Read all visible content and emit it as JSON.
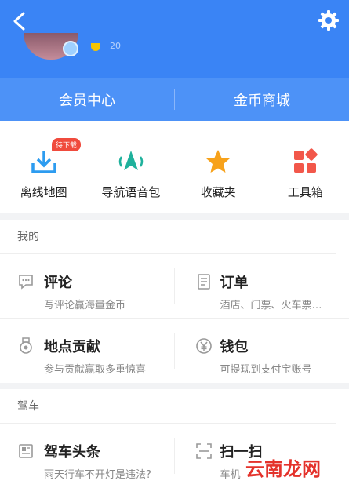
{
  "header": {
    "level_text": "20",
    "tabs": [
      "会员中心",
      "金币商城"
    ]
  },
  "tools": [
    {
      "label": "离线地图",
      "badge": "待下载",
      "icon": "download-icon"
    },
    {
      "label": "导航语音包",
      "icon": "navigation-arrow-icon"
    },
    {
      "label": "收藏夹",
      "icon": "star-icon"
    },
    {
      "label": "工具箱",
      "icon": "toolbox-icon"
    }
  ],
  "mine": {
    "title": "我的",
    "items": [
      {
        "title": "评论",
        "subtitle": "写评论赢海量金币",
        "icon": "comment-icon"
      },
      {
        "title": "订单",
        "subtitle": "酒店、门票、火车票…",
        "icon": "order-icon"
      },
      {
        "title": "地点贡献",
        "subtitle": "参与贡献赢取多重惊喜",
        "icon": "medal-icon"
      },
      {
        "title": "钱包",
        "subtitle": "可提现到支付宝账号",
        "icon": "wallet-yen-icon"
      }
    ]
  },
  "drive": {
    "title": "驾车",
    "items": [
      {
        "title": "驾车头条",
        "subtitle": "雨天行车不开灯是违法?",
        "icon": "news-icon"
      },
      {
        "title": "扫一扫",
        "subtitle": "车机",
        "icon": "scan-icon"
      }
    ]
  },
  "watermark": "云南龙网",
  "colors": {
    "header": "#3a84f5",
    "tabs": "#4d92f7",
    "badge": "#f04b3d",
    "accent_green": "#1fb19c",
    "star": "#f7a21b",
    "tool_red": "#f2574a"
  }
}
